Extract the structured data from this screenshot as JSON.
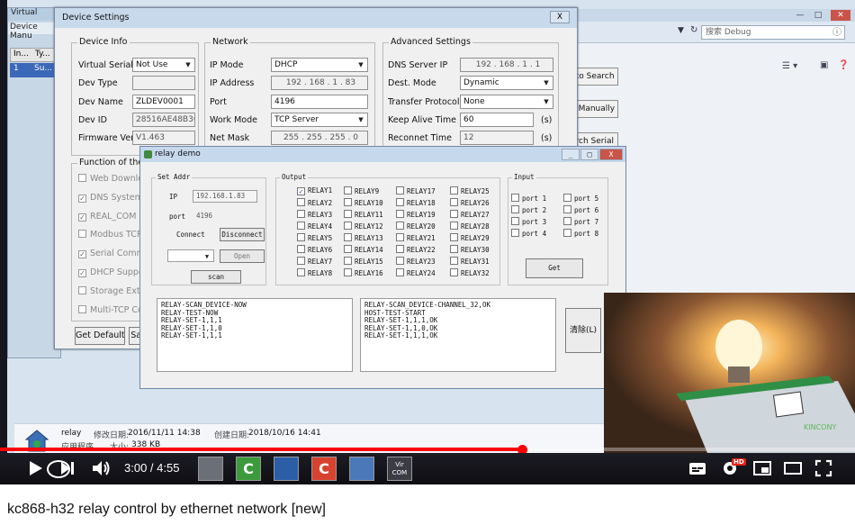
{
  "video_title": "kc868-h32 relay control by ethernet network [new]",
  "player": {
    "time": "3:00 / 4:55",
    "progress_fraction": 0.61,
    "buffer_fraction": 0.62,
    "hd_badge": "HD"
  },
  "bg_window": {
    "title": "Virtual",
    "menu": "Device Manu",
    "table_headers": [
      "In...",
      "Ty..."
    ],
    "row": [
      "1",
      "Su..."
    ]
  },
  "right_window": {
    "search_placeholder": "搜索 Debug",
    "side_buttons": [
      "uto Search",
      "d Manually",
      "arch Serial"
    ]
  },
  "device_settings": {
    "title": "Device Settings",
    "close": "X",
    "device_info": {
      "title": "Device Info",
      "virtual_serial_label": "Virtual Serial",
      "virtual_serial_value": "Not Use",
      "dev_type_label": "Dev Type",
      "dev_type_value": "",
      "dev_name_label": "Dev Name",
      "dev_name_value": "ZLDEV0001",
      "dev_id_label": "Dev ID",
      "dev_id_value": "28516AE48B36",
      "firmware_label": "Firmware Ver",
      "firmware_value": "V1.463"
    },
    "network": {
      "title": "Network",
      "ip_mode_label": "IP Mode",
      "ip_mode_value": "DHCP",
      "ip_address_label": "IP Address",
      "ip_address_value": "192 . 168 . 1 . 83",
      "port_label": "Port",
      "port_value": "4196",
      "work_mode_label": "Work Mode",
      "work_mode_value": "TCP Server",
      "net_mask_label": "Net Mask",
      "net_mask_value": "255 . 255 . 255 . 0"
    },
    "advanced": {
      "title": "Advanced Settings",
      "dns_label": "DNS Server IP",
      "dns_value": "192 . 168 . 1 . 1",
      "dest_mode_label": "Dest. Mode",
      "dest_mode_value": "Dynamic",
      "transfer_label": "Transfer Protocol",
      "transfer_value": "None",
      "keep_alive_label": "Keep Alive Time",
      "keep_alive_value": "60",
      "keep_alive_unit": "(s)",
      "reconnect_label": "Reconnet Time",
      "reconnect_value": "12",
      "reconnect_unit": "(s)"
    },
    "functions": {
      "title": "Function of the dev",
      "items": [
        "Web Download",
        "DNS System",
        "REAL_COM Pr",
        "Modbus TCP To",
        "Serial Comma",
        "DHCP Support",
        "Storage Extend",
        "Multi-TCP Conn"
      ],
      "checked": [
        false,
        true,
        true,
        false,
        true,
        true,
        false,
        false
      ]
    },
    "buttons": {
      "get_default": "Get Default",
      "save": "Sav"
    }
  },
  "relay_demo": {
    "title": "relay demo",
    "controls": [
      "_",
      "□",
      "X"
    ],
    "set_addr": {
      "title": "Set Addr",
      "ip_label": "IP",
      "ip_value": "192.168.1.83",
      "port_label": "port",
      "port_value": "4196",
      "connect_label": "Connect",
      "disconnect_button": "Disconnect",
      "open_button": "Open",
      "scan_button": "scan"
    },
    "output": {
      "title": "Output",
      "relays": [
        "RELAY1",
        "RELAY2",
        "RELAY3",
        "RELAY4",
        "RELAY5",
        "RELAY6",
        "RELAY7",
        "RELAY8",
        "RELAY9",
        "RELAY10",
        "RELAY11",
        "RELAY12",
        "RELAY13",
        "RELAY14",
        "RELAY15",
        "RELAY16",
        "RELAY17",
        "RELAY18",
        "RELAY19",
        "RELAY20",
        "RELAY21",
        "RELAY22",
        "RELAY23",
        "RELAY24",
        "RELAY25",
        "RELAY26",
        "RELAY27",
        "RELAY28",
        "RELAY29",
        "RELAY30",
        "RELAY31",
        "RELAY32"
      ],
      "checked": [
        "RELAY1"
      ]
    },
    "input": {
      "title": "Input",
      "ports": [
        "port 1",
        "port 2",
        "port 3",
        "port 4",
        "port 5",
        "port 6",
        "port 7",
        "port 8"
      ],
      "get_button": "Get"
    },
    "log_left": [
      "RELAY-SCAN_DEVICE-NOW",
      "RELAY-TEST-NOW",
      "RELAY-SET-1,1,1",
      "RELAY-SET-1,1,0",
      "RELAY-SET-1,1,1"
    ],
    "log_right": [
      "RELAY-SCAN_DEVICE-CHANNEL_32,OK",
      "HOST-TEST-START",
      "RELAY-SET-1,1,1,OK",
      "RELAY-SET-1,1,0,OK",
      "RELAY-SET-1,1,1,OK"
    ],
    "clear_button": "清除(L)"
  },
  "file_info": {
    "name": "relay",
    "modified_label": "修改日期:",
    "modified_value": "2016/11/11 14:38",
    "created_label": "创建日期:",
    "created_value": "2018/10/16 14:41",
    "type": "应用程序",
    "size_label": "大小:",
    "size_value": "338 KB"
  },
  "taskbar": {
    "items": [
      "explorer",
      "ie",
      "green-app",
      "image",
      "red-app",
      "network",
      "com"
    ],
    "com_label": "Vir\nCOM"
  },
  "pip": {
    "brand": "KINCONY"
  },
  "colors": {
    "progress": "#ff0000",
    "titlebar": "#c8d9ec"
  }
}
